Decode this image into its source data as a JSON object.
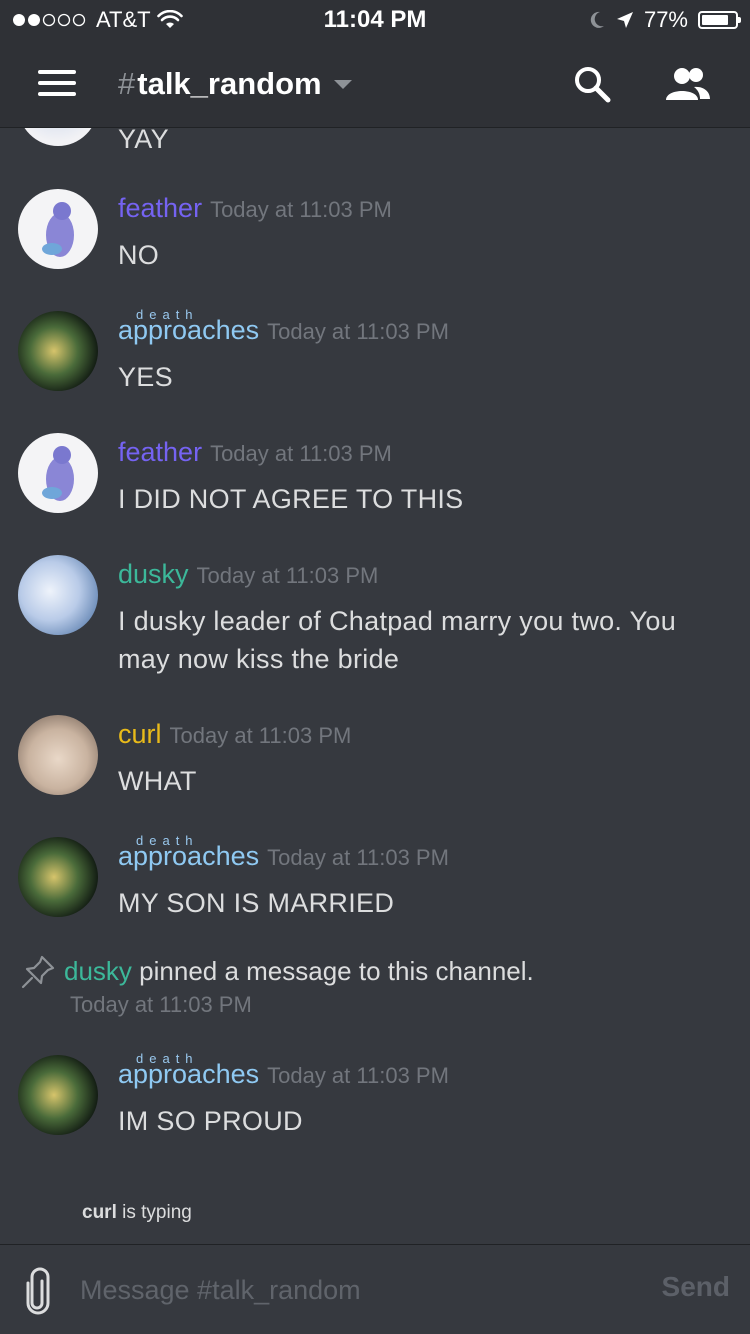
{
  "status_bar": {
    "carrier": "AT&T",
    "time": "11:04 PM",
    "battery": "77%",
    "battery_level": 0.77
  },
  "header": {
    "channel_hash": "#",
    "channel_name": "talk_random",
    "icons": [
      "menu-icon",
      "search-icon",
      "members-icon"
    ]
  },
  "messages": [
    {
      "author": "",
      "timestamp": "",
      "text": "YAY"
    },
    {
      "author": "feather",
      "timestamp": "Today at 11:03 PM",
      "text": "NO"
    },
    {
      "author": "approaches",
      "author_prefix": "death",
      "timestamp": "Today at 11:03 PM",
      "text": "YES"
    },
    {
      "author": "feather",
      "timestamp": "Today at 11:03 PM",
      "text": "I DID NOT AGREE TO THIS"
    },
    {
      "author": "dusky",
      "timestamp": "Today at 11:03 PM",
      "text": "I dusky leader of Chatpad marry you two. You may now kiss the bride"
    },
    {
      "author": "curl",
      "timestamp": "Today at 11:03 PM",
      "text": "WHAT"
    },
    {
      "author": "approaches",
      "author_prefix": "death",
      "timestamp": "Today at 11:03 PM",
      "text": "MY SON IS MARRIED"
    },
    {
      "author": "approaches",
      "author_prefix": "death",
      "timestamp": "Today at 11:03 PM",
      "text": "IM SO PROUD"
    }
  ],
  "system_message": {
    "author": "dusky",
    "text": "pinned a message to this channel.",
    "timestamp": "Today at 11:03 PM"
  },
  "typing": {
    "user": "curl",
    "text": "is typing"
  },
  "input": {
    "placeholder": "Message #talk_random",
    "value": "",
    "send_label": "Send"
  },
  "colors": {
    "feather": "#7563f2",
    "approaches": "#8fc9f2",
    "dusky": "#3cb89a",
    "curl": "#e8ba1a",
    "background": "#36393f",
    "header": "#2f3136"
  }
}
